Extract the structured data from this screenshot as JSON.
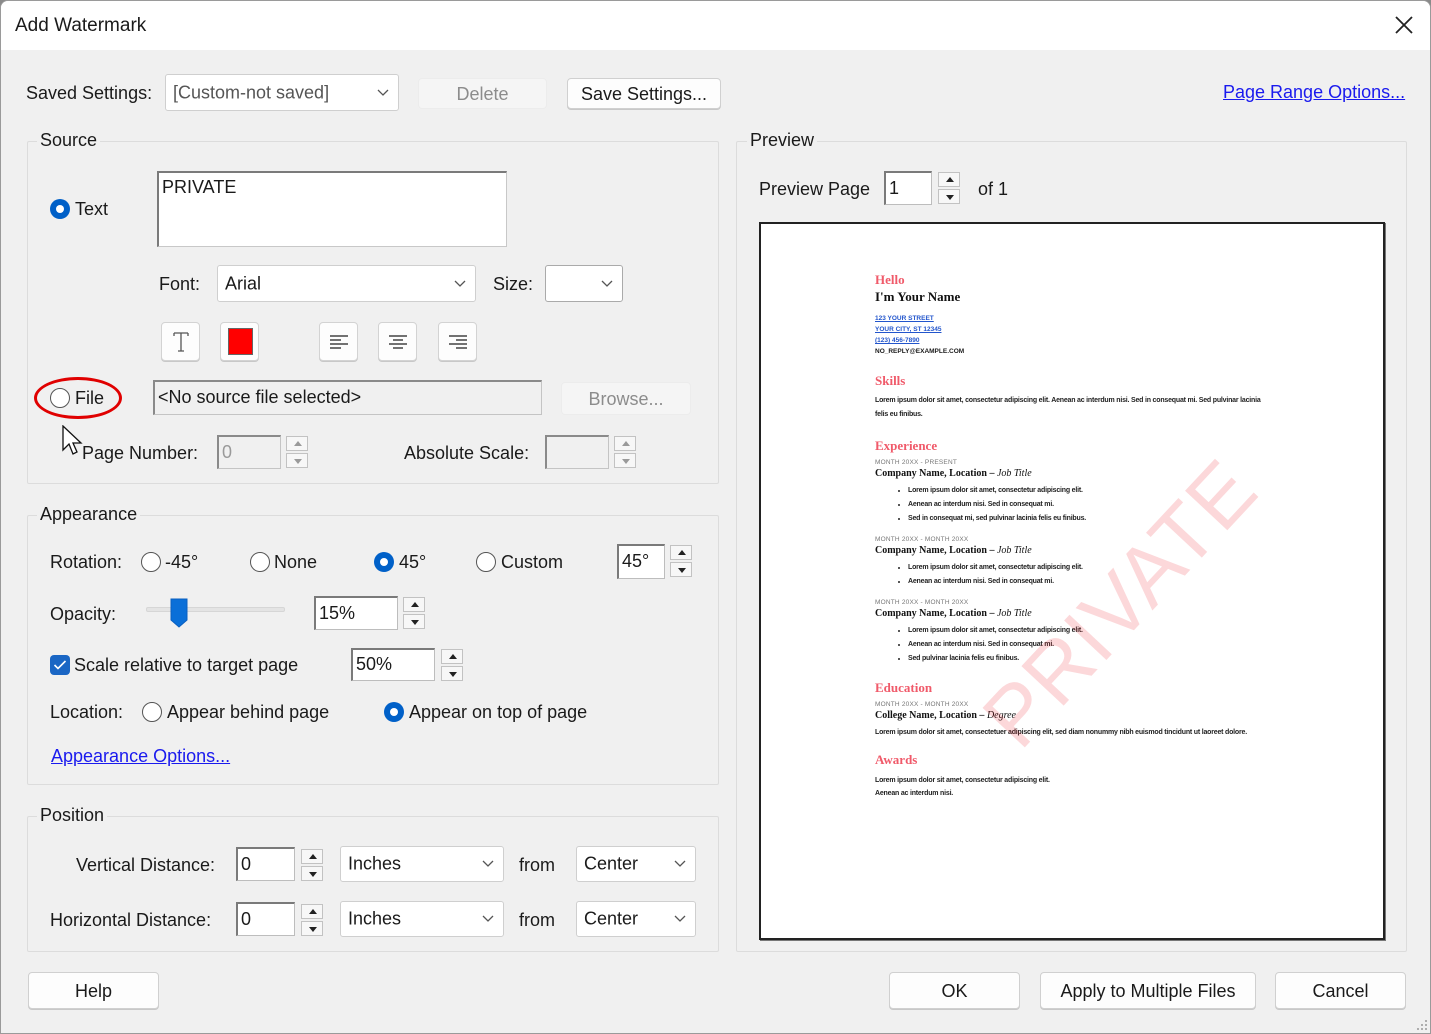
{
  "window": {
    "title": "Add Watermark",
    "close_icon": "close-icon"
  },
  "saved_settings": {
    "label": "Saved Settings:",
    "value": "[Custom-not saved]",
    "delete_label": "Delete",
    "save_label": "Save Settings...",
    "page_range_link": "Page Range Options..."
  },
  "source": {
    "title": "Source",
    "text_option": {
      "label": "Text",
      "selected": true
    },
    "text_value": "PRIVATE",
    "font_label": "Font:",
    "font_value": "Arial",
    "size_label": "Size:",
    "size_value": "",
    "text_color": "#ff0000",
    "format_buttons": [
      "text-format-icon",
      "color-swatch",
      "align-left-icon",
      "align-center-icon",
      "align-right-icon"
    ],
    "file_option": {
      "label": "File",
      "selected": false
    },
    "file_value": "<No source file selected>",
    "browse_label": "Browse...",
    "page_number_label": "Page Number:",
    "page_number_value": "0",
    "absolute_scale_label": "Absolute Scale:",
    "absolute_scale_value": ""
  },
  "appearance": {
    "title": "Appearance",
    "rotation_label": "Rotation:",
    "rotation_options": [
      {
        "label": "-45°",
        "selected": false
      },
      {
        "label": "None",
        "selected": false
      },
      {
        "label": "45°",
        "selected": true
      },
      {
        "label": "Custom",
        "selected": false
      }
    ],
    "rotation_value": "45°",
    "opacity_label": "Opacity:",
    "opacity_value": "15%",
    "opacity_slider_percent": 15,
    "scale_checkbox": {
      "label": "Scale relative to target page",
      "checked": true
    },
    "scale_value": "50%",
    "location_label": "Location:",
    "location_options": [
      {
        "label": "Appear behind page",
        "selected": false
      },
      {
        "label": "Appear on top of page",
        "selected": true
      }
    ],
    "options_link": "Appearance Options..."
  },
  "position": {
    "title": "Position",
    "vertical_label": "Vertical Distance:",
    "vertical_value": "0",
    "vertical_unit": "Inches",
    "vertical_from_label": "from",
    "vertical_from": "Center",
    "horizontal_label": "Horizontal Distance:",
    "horizontal_value": "0",
    "horizontal_unit": "Inches",
    "horizontal_from_label": "from",
    "horizontal_from": "Center"
  },
  "preview": {
    "title": "Preview",
    "page_label": "Preview Page",
    "page_value": "1",
    "page_of": "of 1",
    "watermark_text": "PRIVATE",
    "watermark_color": "#f02832",
    "document": {
      "greeting": "Hello",
      "name": "I'm Your Name",
      "contact": [
        "123 YOUR STREET",
        "YOUR CITY, ST 12345",
        "(123) 456-7890",
        "NO_REPLY@EXAMPLE.COM"
      ],
      "skills_heading": "Skills",
      "skills_text": "Lorem ipsum dolor sit amet, consectetur adipiscing elit. Aenean ac interdum nisi. Sed in consequat mi. Sed pulvinar lacinia felis eu finibus.",
      "experience_heading": "Experience",
      "jobs": [
        {
          "dates": "MONTH 20XX - PRESENT",
          "company": "Company Name, Location – ",
          "title": "Job Title",
          "bullets": [
            "Lorem ipsum dolor sit amet, consectetur adipiscing elit.",
            "Aenean ac interdum nisi. Sed in consequat mi.",
            "Sed in consequat mi, sed pulvinar lacinia felis eu finibus."
          ]
        },
        {
          "dates": "MONTH 20XX - MONTH 20XX",
          "company": "Company Name, Location – ",
          "title": "Job Title",
          "bullets": [
            "Lorem ipsum dolor sit amet, consectetur adipiscing elit.",
            "Aenean ac interdum nisi. Sed in consequat mi."
          ]
        },
        {
          "dates": "MONTH 20XX - MONTH 20XX",
          "company": "Company Name, Location – ",
          "title": "Job Title",
          "bullets": [
            "Lorem ipsum dolor sit amet, consectetur adipiscing elit.",
            "Aenean ac interdum nisi. Sed in consequat mi.",
            "Sed pulvinar lacinia felis eu finibus."
          ]
        }
      ],
      "education_heading": "Education",
      "education_dates": "MONTH 20XX - MONTH 20XX",
      "education_school": "College Name, Location – ",
      "education_degree": "Degree",
      "education_text": "Lorem ipsum dolor sit amet, consectetuer adipiscing elit, sed diam nonummy nibh euismod tincidunt ut laoreet dolore.",
      "awards_heading": "Awards",
      "awards_lines": [
        "Lorem ipsum dolor sit amet, consectetur adipiscing elit.",
        "Aenean ac interdum nisi."
      ]
    }
  },
  "footer": {
    "help_label": "Help",
    "ok_label": "OK",
    "apply_multiple_label": "Apply to Multiple Files",
    "cancel_label": "Cancel"
  }
}
